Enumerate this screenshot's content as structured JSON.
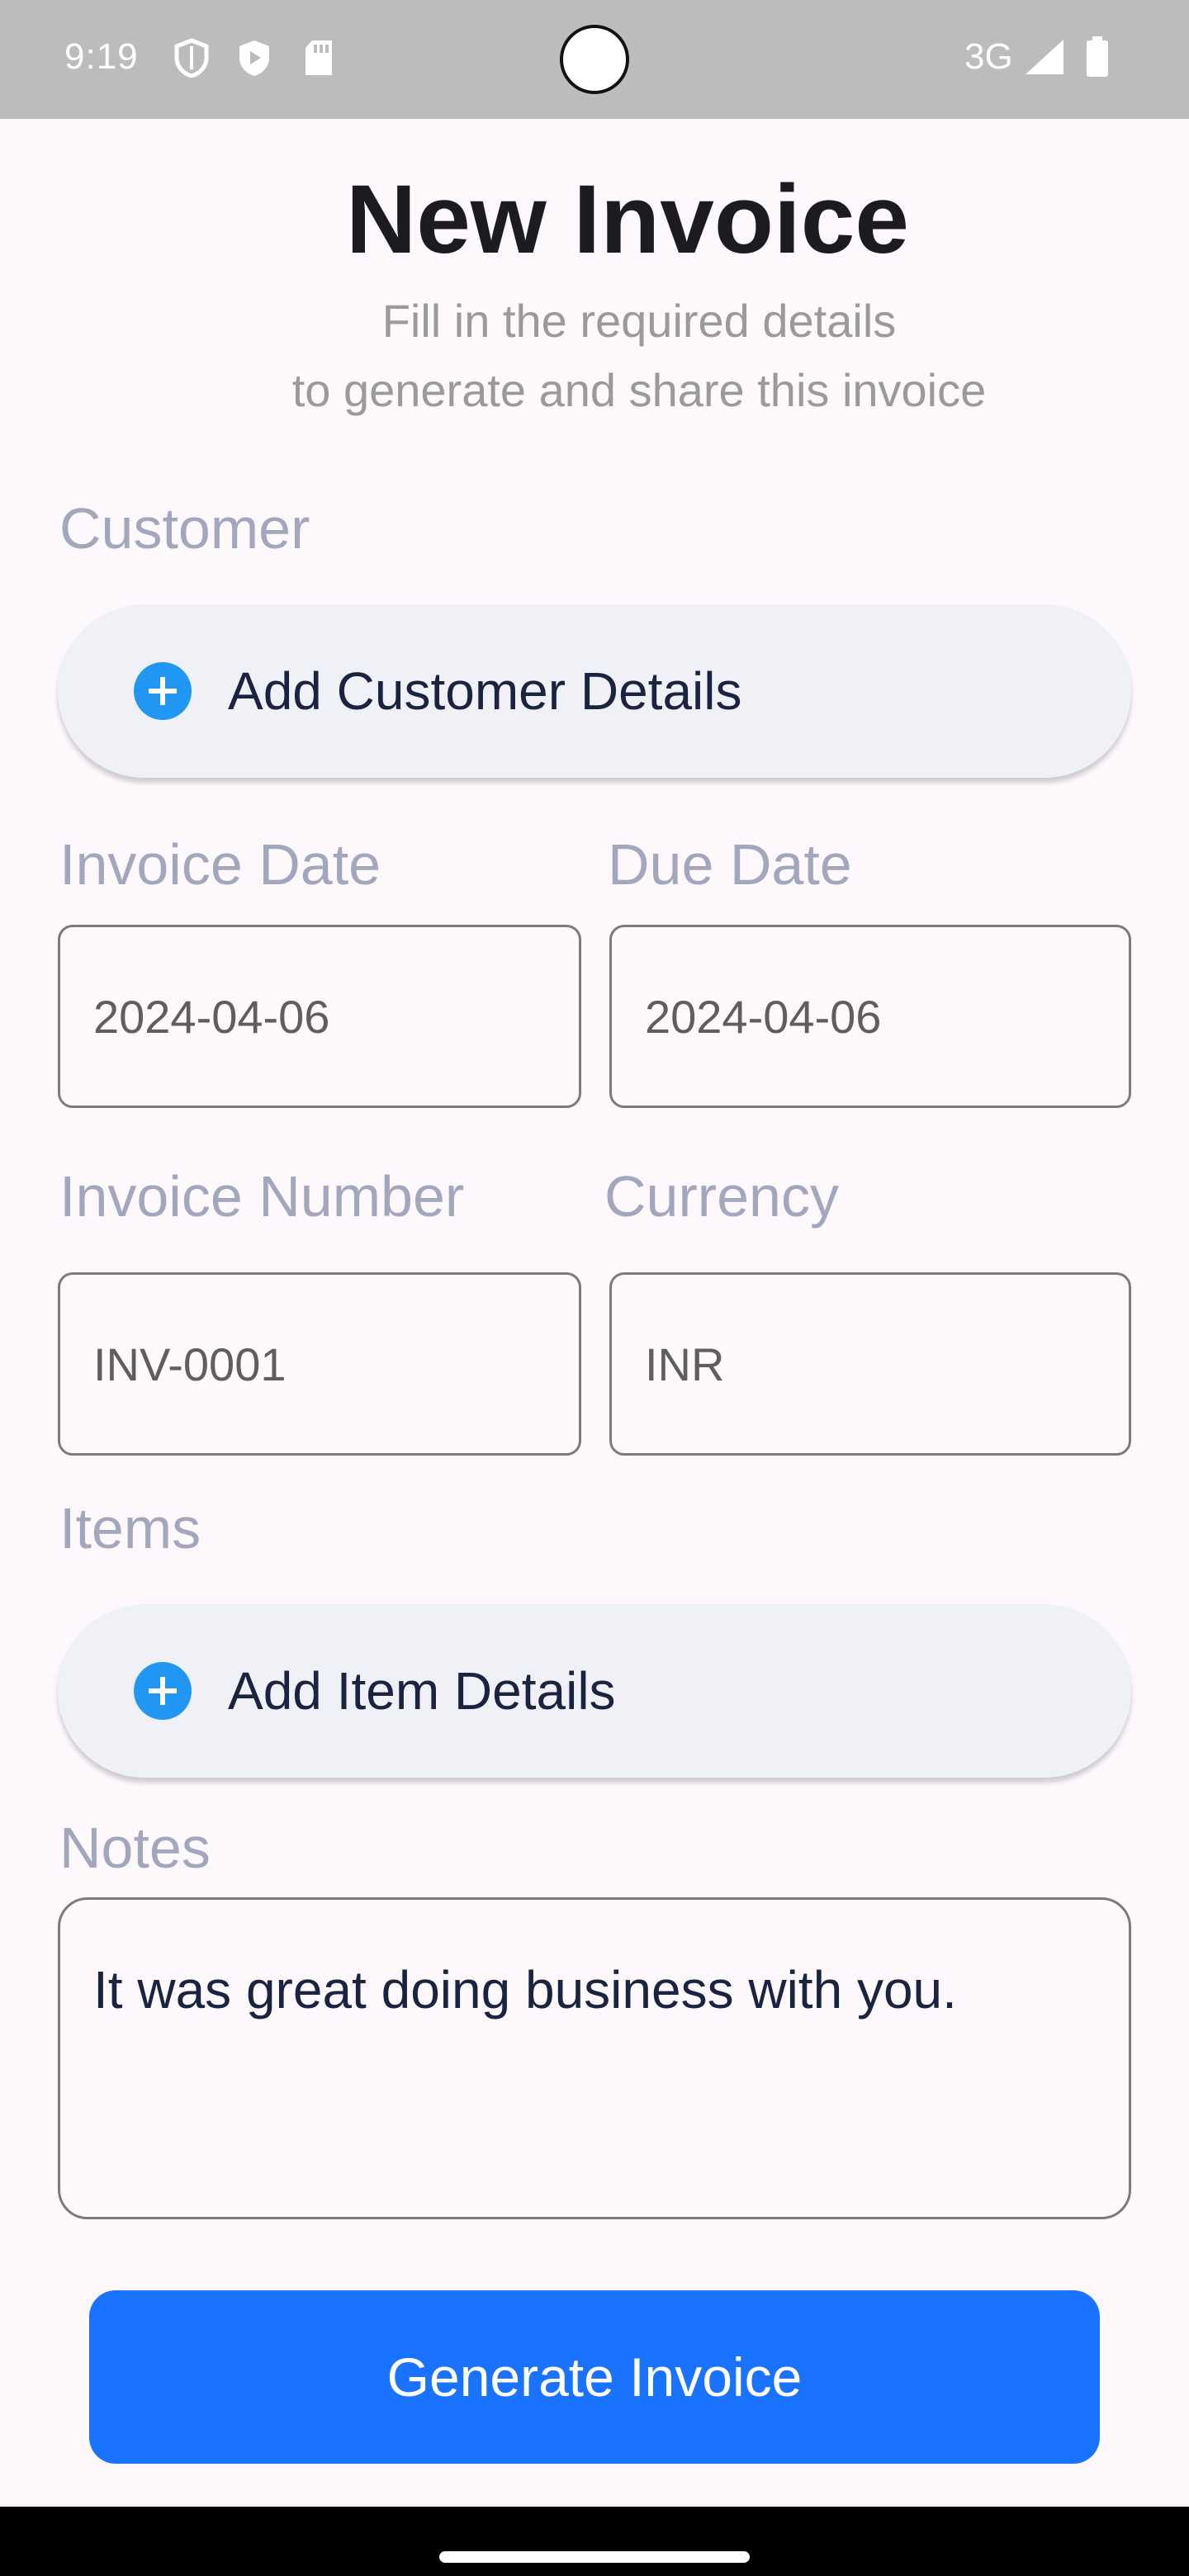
{
  "status_bar": {
    "time": "9:19",
    "network": "3G",
    "left_icons": [
      "shield-icon",
      "play-protect-icon",
      "sd-card-icon"
    ],
    "right_icons": [
      "signal-icon",
      "battery-icon"
    ]
  },
  "header": {
    "title": "New Invoice",
    "subtitle_line1": "Fill in the required details",
    "subtitle_line2": "to generate and share this invoice"
  },
  "customer": {
    "label": "Customer",
    "button_label": "Add Customer Details"
  },
  "dates": {
    "invoice_date_label": "Invoice Date",
    "invoice_date_value": "2024-04-06",
    "due_date_label": "Due Date",
    "due_date_value": "2024-04-06"
  },
  "meta": {
    "invoice_number_label": "Invoice Number",
    "invoice_number_value": "INV-0001",
    "currency_label": "Currency",
    "currency_value": "INR"
  },
  "items": {
    "label": "Items",
    "button_label": "Add Item Details"
  },
  "notes": {
    "label": "Notes",
    "value": "It was great doing business with you."
  },
  "actions": {
    "generate_label": "Generate Invoice"
  },
  "colors": {
    "primary": "#1a73ff",
    "plus_icon": "#2196f3",
    "label": "#a3a7bd",
    "status_bar": "#bdbcbc"
  }
}
